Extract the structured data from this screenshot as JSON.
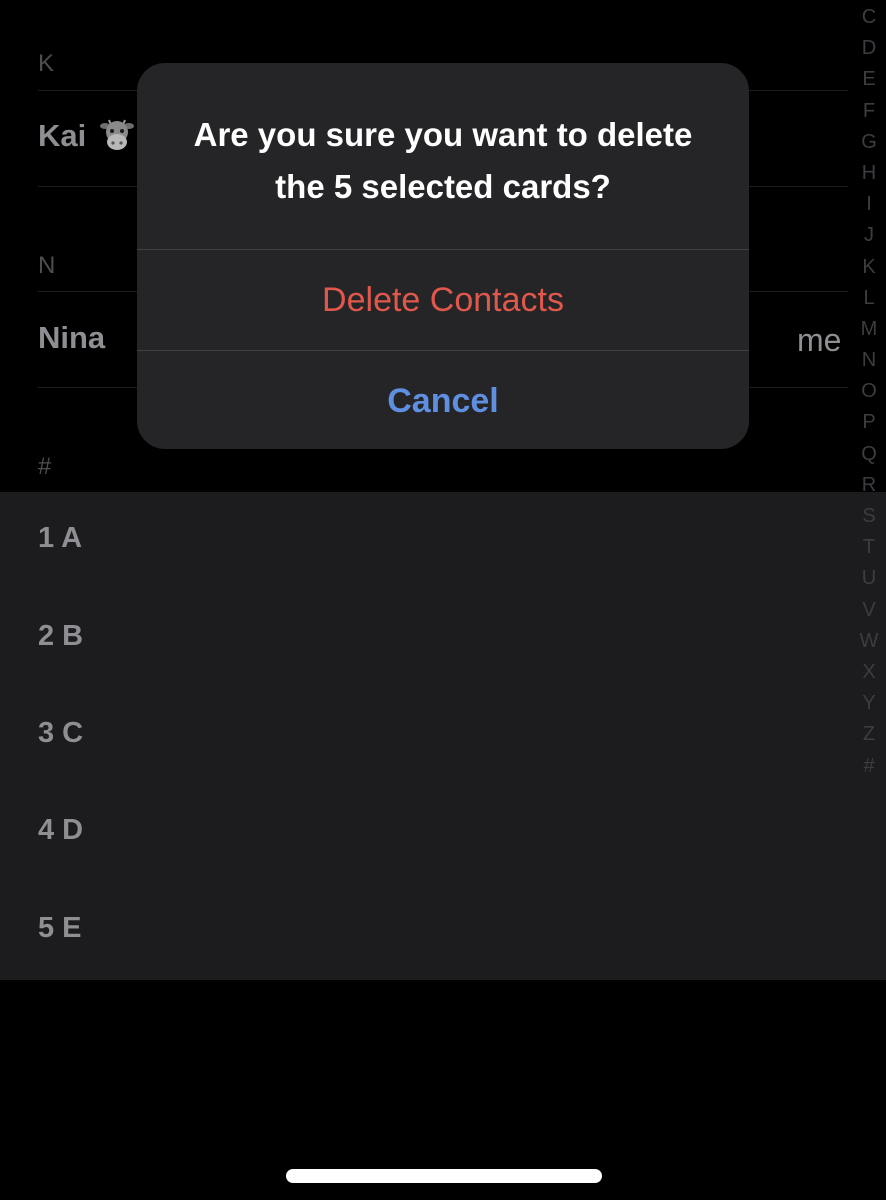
{
  "sections": [
    {
      "letter": "K",
      "contacts": [
        {
          "name": "Kai",
          "emoji": "cow-face-emoji"
        }
      ]
    },
    {
      "letter": "N",
      "contacts": [
        {
          "name": "Nina",
          "tag": "me"
        }
      ]
    },
    {
      "letter": "#",
      "contacts": []
    }
  ],
  "selected_rows": [
    "1 A",
    "2 B",
    "3 C",
    "4 D",
    "5 E"
  ],
  "alphabet_index": [
    "C",
    "D",
    "E",
    "F",
    "G",
    "H",
    "I",
    "J",
    "K",
    "L",
    "M",
    "N",
    "O",
    "P",
    "Q",
    "R",
    "S",
    "T",
    "U",
    "V",
    "W",
    "X",
    "Y",
    "Z",
    "#"
  ],
  "alert": {
    "title": "Are you sure you want to delete the 5 selected cards?",
    "destructive_label": "Delete Contacts",
    "cancel_label": "Cancel"
  },
  "colors": {
    "destructive": "#e0584b",
    "accent": "#5f8fe0",
    "alert_background": "#252527"
  }
}
